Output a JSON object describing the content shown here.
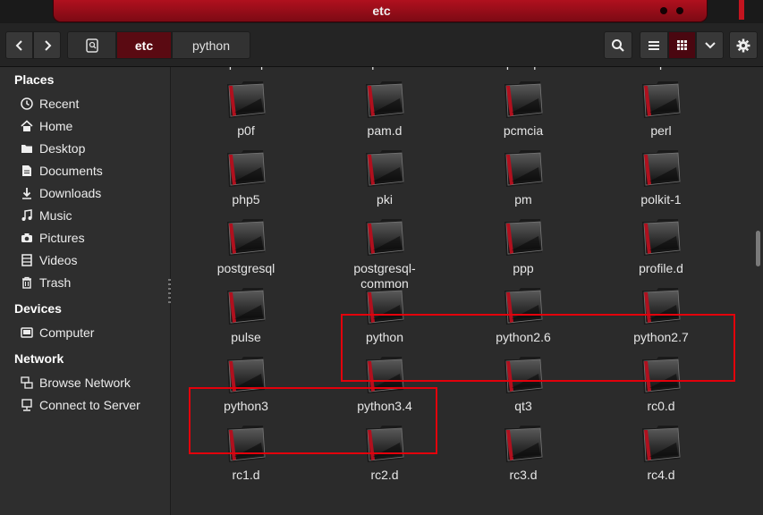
{
  "window": {
    "title": "etc"
  },
  "toolbar": {
    "back_icon": "chevron-left-icon",
    "forward_icon": "chevron-right-icon",
    "location_icon": "location-toggle-icon",
    "breadcrumb": [
      "etc",
      "python"
    ],
    "search_icon": "search-icon",
    "list_view_icon": "list-view-icon",
    "grid_view_icon": "grid-view-icon",
    "view_menu_icon": "chevron-down-icon",
    "settings_icon": "gear-icon"
  },
  "sidebar": {
    "places_heading": "Places",
    "places": [
      {
        "label": "Recent",
        "icon": "clock-icon"
      },
      {
        "label": "Home",
        "icon": "home-icon"
      },
      {
        "label": "Desktop",
        "icon": "folder-icon"
      },
      {
        "label": "Documents",
        "icon": "document-icon"
      },
      {
        "label": "Downloads",
        "icon": "download-icon"
      },
      {
        "label": "Music",
        "icon": "music-icon"
      },
      {
        "label": "Pictures",
        "icon": "camera-icon"
      },
      {
        "label": "Videos",
        "icon": "film-icon"
      },
      {
        "label": "Trash",
        "icon": "trash-icon"
      }
    ],
    "devices_heading": "Devices",
    "devices": [
      {
        "label": "Computer",
        "icon": "drive-icon"
      }
    ],
    "network_heading": "Network",
    "network": [
      {
        "label": "Browse Network",
        "icon": "network-icon"
      },
      {
        "label": "Connect to Server",
        "icon": "server-icon"
      }
    ]
  },
  "files": [
    [
      "openmpi",
      "opensc",
      "openvpn",
      "opt"
    ],
    [
      "p0f",
      "pam.d",
      "pcmcia",
      "perl"
    ],
    [
      "php5",
      "pki",
      "pm",
      "polkit-1"
    ],
    [
      "postgresql",
      "postgresql-common",
      "ppp",
      "profile.d"
    ],
    [
      "pulse",
      "python",
      "python2.6",
      "python2.7"
    ],
    [
      "python3",
      "python3.4",
      "qt3",
      "rc0.d"
    ],
    [
      "rc1.d",
      "rc2.d",
      "rc3.d",
      "rc4.d"
    ]
  ],
  "colors": {
    "accent": "#b0101e",
    "highlight": "#e3000b"
  }
}
